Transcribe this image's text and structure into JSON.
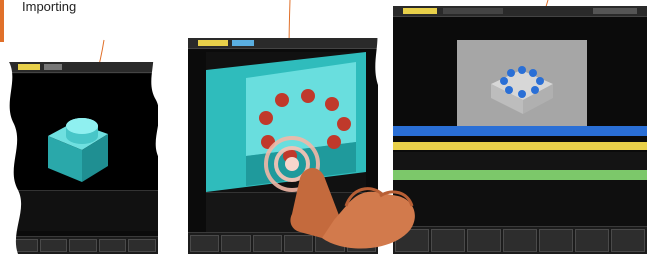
{
  "callout": {
    "label": "Importing"
  },
  "colors": {
    "accent": "#e0702a",
    "part": "#3fc8c8",
    "hole": "#c0392b",
    "timeline_blue": "#2a6fd6",
    "timeline_yellow": "#e8d04a",
    "timeline_green": "#7cc86a"
  },
  "icons": [
    "touch-ripple-icon",
    "pointing-hand-icon"
  ]
}
